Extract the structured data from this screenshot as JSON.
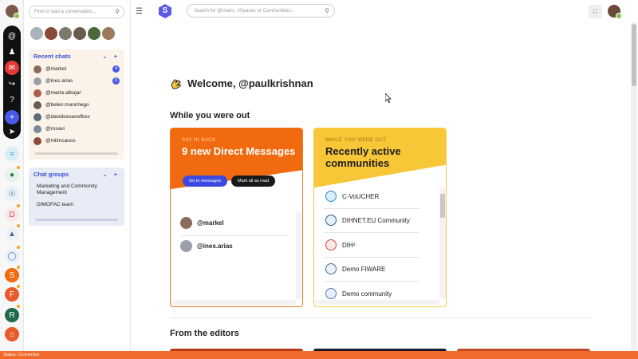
{
  "left_panel": {
    "search_placeholder": "Find or start a conversation...",
    "recent": {
      "title": "Recent chats",
      "controls": "⌄ +",
      "items": [
        {
          "name": "@markel",
          "badge": "4",
          "color": "#8a6a5a"
        },
        {
          "name": "@ines.arias",
          "badge": "3",
          "color": "#9aa0a8"
        },
        {
          "name": "@marta.albujar",
          "badge": "",
          "color": "#b05a4a"
        },
        {
          "name": "@belen.manchego",
          "badge": "",
          "color": "#6a5a4a"
        },
        {
          "name": "@davidseoanefbox",
          "badge": "",
          "color": "#5a6a7a"
        },
        {
          "name": "@rosavi",
          "badge": "",
          "color": "#7a8a9a"
        },
        {
          "name": "@mlimcaoco",
          "badge": "",
          "color": "#8a4a3a"
        }
      ]
    },
    "groups": {
      "title": "Chat groups",
      "controls": "⌄ +",
      "items": [
        "Marketing and Community Management",
        "DIMOFAC team"
      ]
    }
  },
  "topbar": {
    "logo_letter": "S",
    "search_placeholder": "Search for @Users, #Spaces or Communities..."
  },
  "main": {
    "welcome": "Welcome, @paulkrishnan",
    "while_out_title": "While you were out",
    "editors_title": "From the editors",
    "dm_card": {
      "kicker": "SAY HI BACK",
      "title": "9 new Direct Messages",
      "go_label": "Go to messages",
      "mark_label": "Mark all as read",
      "items": [
        "@markel",
        "@ines.arias"
      ]
    },
    "communities_card": {
      "kicker": "WHILE YOU WERE OUT",
      "title": "Recently active communities",
      "items": [
        "C-VoUCHER",
        "DIHNET.EU Community",
        "DIH²",
        "Demo FIWARE",
        "Demo community"
      ]
    }
  },
  "status": "Status: Connected",
  "colors": {
    "accent": "#3b49e0",
    "orange": "#f26a0f",
    "yellow": "#f7c738",
    "status": "#f06a2c"
  }
}
